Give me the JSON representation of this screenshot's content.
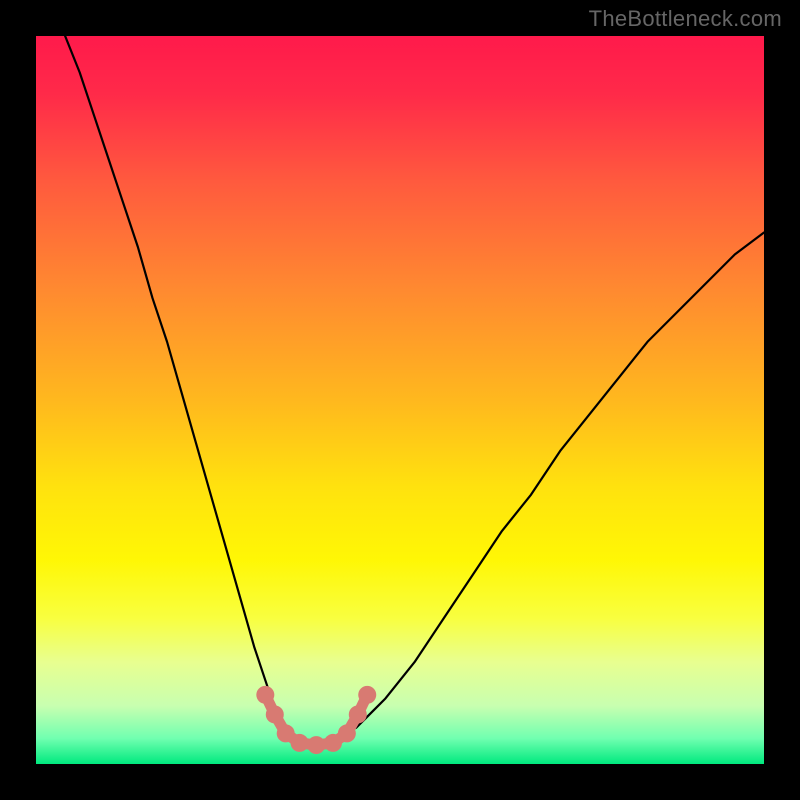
{
  "watermark": "TheBottleneck.com",
  "chart_data": {
    "type": "line",
    "title": "",
    "xlabel": "",
    "ylabel": "",
    "xlim": [
      0,
      100
    ],
    "ylim": [
      0,
      100
    ],
    "background_gradient": {
      "stops": [
        {
          "offset": 0.0,
          "color": "#ff1a4b"
        },
        {
          "offset": 0.08,
          "color": "#ff2a49"
        },
        {
          "offset": 0.2,
          "color": "#ff5a3e"
        },
        {
          "offset": 0.35,
          "color": "#ff8a30"
        },
        {
          "offset": 0.5,
          "color": "#ffb81e"
        },
        {
          "offset": 0.62,
          "color": "#ffe20e"
        },
        {
          "offset": 0.72,
          "color": "#fff705"
        },
        {
          "offset": 0.8,
          "color": "#f8ff40"
        },
        {
          "offset": 0.86,
          "color": "#e8ff90"
        },
        {
          "offset": 0.92,
          "color": "#c8ffb0"
        },
        {
          "offset": 0.965,
          "color": "#70ffb0"
        },
        {
          "offset": 1.0,
          "color": "#00e97e"
        }
      ]
    },
    "series": [
      {
        "name": "curve-left",
        "stroke": "#000000",
        "stroke_width": 2.2,
        "x": [
          4,
          6,
          8,
          10,
          12,
          14,
          16,
          18,
          20,
          22,
          24,
          26,
          28,
          30,
          32,
          33,
          34,
          35
        ],
        "y": [
          100,
          95,
          89,
          83,
          77,
          71,
          64,
          58,
          51,
          44,
          37,
          30,
          23,
          16,
          10,
          7,
          5,
          4
        ]
      },
      {
        "name": "curve-right",
        "stroke": "#000000",
        "stroke_width": 2.2,
        "x": [
          42,
          44,
          46,
          48,
          52,
          56,
          60,
          64,
          68,
          72,
          76,
          80,
          84,
          88,
          92,
          96,
          100
        ],
        "y": [
          4,
          5,
          7,
          9,
          14,
          20,
          26,
          32,
          37,
          43,
          48,
          53,
          58,
          62,
          66,
          70,
          73
        ]
      },
      {
        "name": "trough-marker",
        "type": "marker-chain",
        "stroke": "#d87a72",
        "fill": "#d87a72",
        "dot_radius": 9,
        "connector_width": 11,
        "points": [
          {
            "x": 31.5,
            "y": 9.5
          },
          {
            "x": 32.8,
            "y": 6.8
          },
          {
            "x": 34.3,
            "y": 4.2
          },
          {
            "x": 36.2,
            "y": 2.9
          },
          {
            "x": 38.5,
            "y": 2.6
          },
          {
            "x": 40.8,
            "y": 2.9
          },
          {
            "x": 42.7,
            "y": 4.2
          },
          {
            "x": 44.2,
            "y": 6.8
          },
          {
            "x": 45.5,
            "y": 9.5
          }
        ]
      }
    ]
  }
}
